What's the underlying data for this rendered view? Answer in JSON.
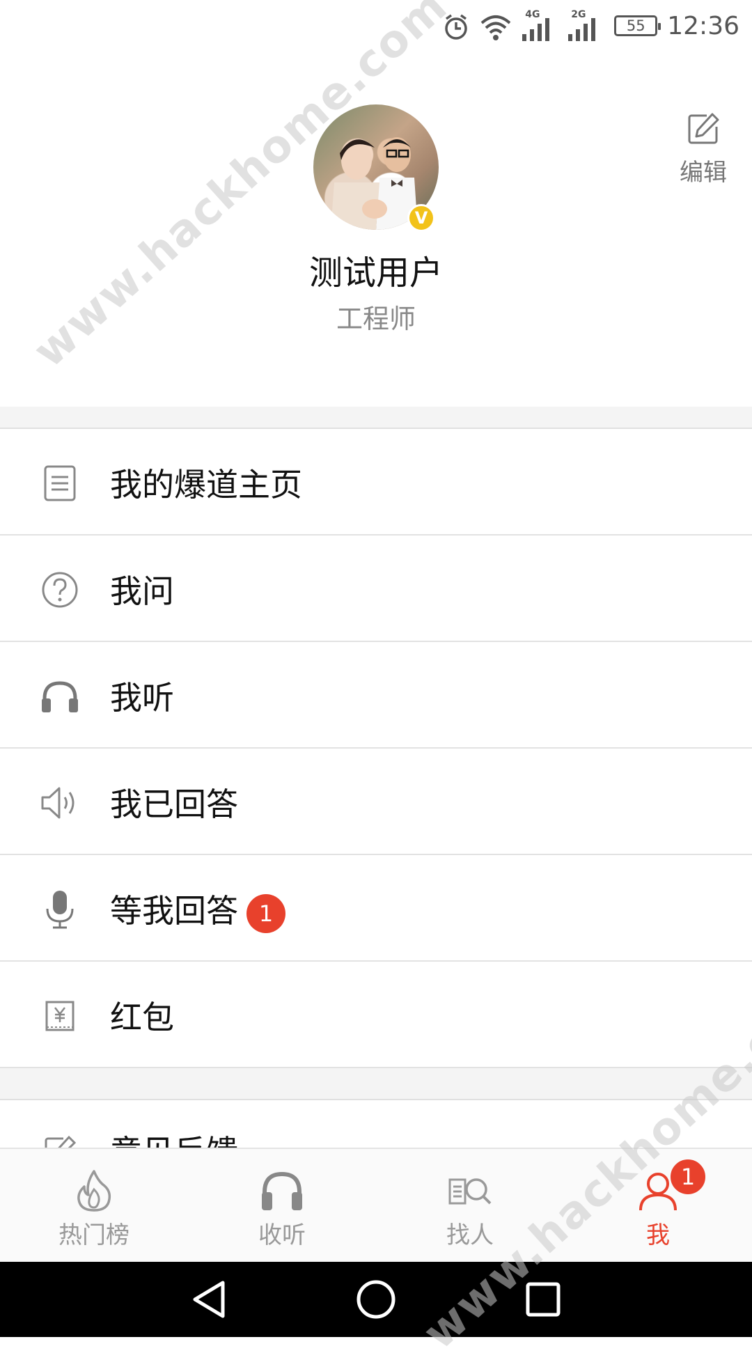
{
  "status_bar": {
    "network_1": "4G",
    "network_2": "2G",
    "battery": "55",
    "time": "12:36",
    "icons": [
      "alarm-icon",
      "wifi-icon",
      "signal-icon",
      "signal-icon",
      "battery-icon"
    ]
  },
  "profile": {
    "name": "测试用户",
    "title": "工程师",
    "verified_badge": "V",
    "edit_label": "编辑",
    "edit_icon": "pencil-icon"
  },
  "menu": {
    "items": [
      {
        "label": "我的爆道主页",
        "icon": "document-icon"
      },
      {
        "label": "我问",
        "icon": "question-circle-icon"
      },
      {
        "label": "我听",
        "icon": "headphones-icon"
      },
      {
        "label": "我已回答",
        "icon": "speaker-icon"
      },
      {
        "label": "等我回答",
        "icon": "microphone-icon",
        "badge": "1"
      },
      {
        "label": "红包",
        "icon": "red-envelope-icon"
      }
    ],
    "partial_item": {
      "label": "意见反馈",
      "icon": "edit-icon"
    }
  },
  "tabbar": {
    "tabs": [
      {
        "label": "热门榜",
        "icon": "flame-icon",
        "active": false
      },
      {
        "label": "收听",
        "icon": "headphones-icon",
        "active": false
      },
      {
        "label": "找人",
        "icon": "search-people-icon",
        "active": false
      },
      {
        "label": "我",
        "icon": "person-icon",
        "active": true,
        "badge": "1"
      }
    ]
  },
  "navbar": {
    "icons": [
      "back-triangle-icon",
      "home-circle-icon",
      "recents-square-icon"
    ]
  },
  "watermark": {
    "text": "www.hackhome.com"
  },
  "colors": {
    "accent": "#e8412c",
    "verified": "#f2c21a",
    "muted_text": "#888888",
    "separator_bg": "#f4f4f4"
  }
}
